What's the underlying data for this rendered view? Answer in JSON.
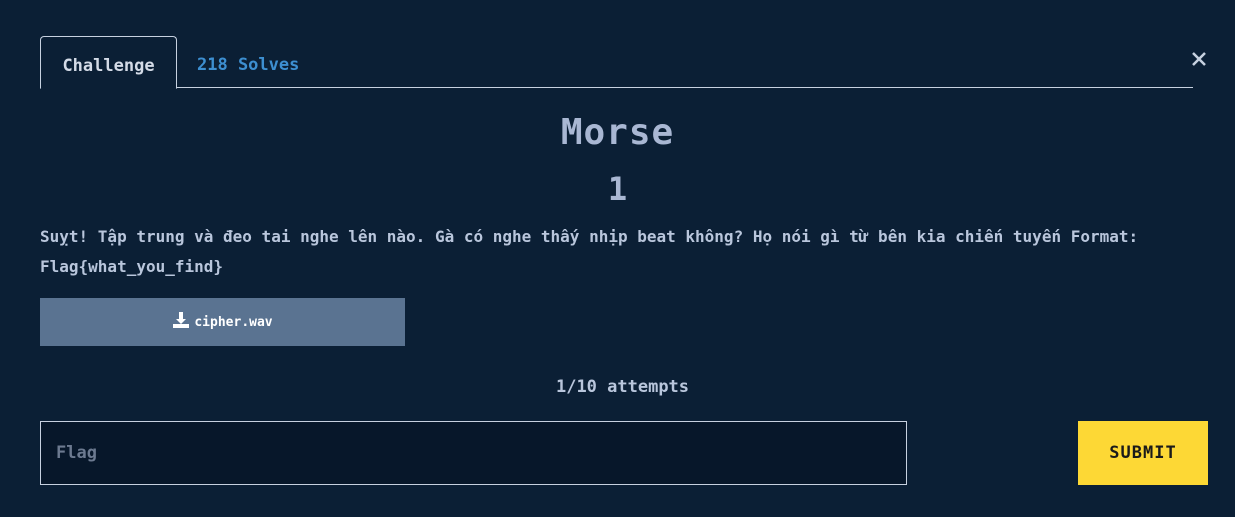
{
  "tabs": {
    "challenge": "Challenge",
    "solves": "218 Solves"
  },
  "challenge": {
    "name": "Morse",
    "points": "1",
    "description_line1": "Suỵt! Tập trung và đeo tai nghe lên nào. Gà có nghe thấy nhịp beat không? Họ nói gì từ bên kia chiến tuyến Format:",
    "description_line2": "Flag{what_you_find}",
    "file_name": "cipher.wav",
    "file_icon": "download-icon"
  },
  "attempts": "1/10 attempts",
  "form": {
    "flag_placeholder": "Flag",
    "flag_value": "",
    "submit_label": "SUBMIT"
  },
  "close_icon": "close-icon",
  "colors": {
    "background": "#0b1f35",
    "solves_tab": "#3d8fd1",
    "file_button": "#5a7391",
    "submit_button": "#fdd835"
  }
}
